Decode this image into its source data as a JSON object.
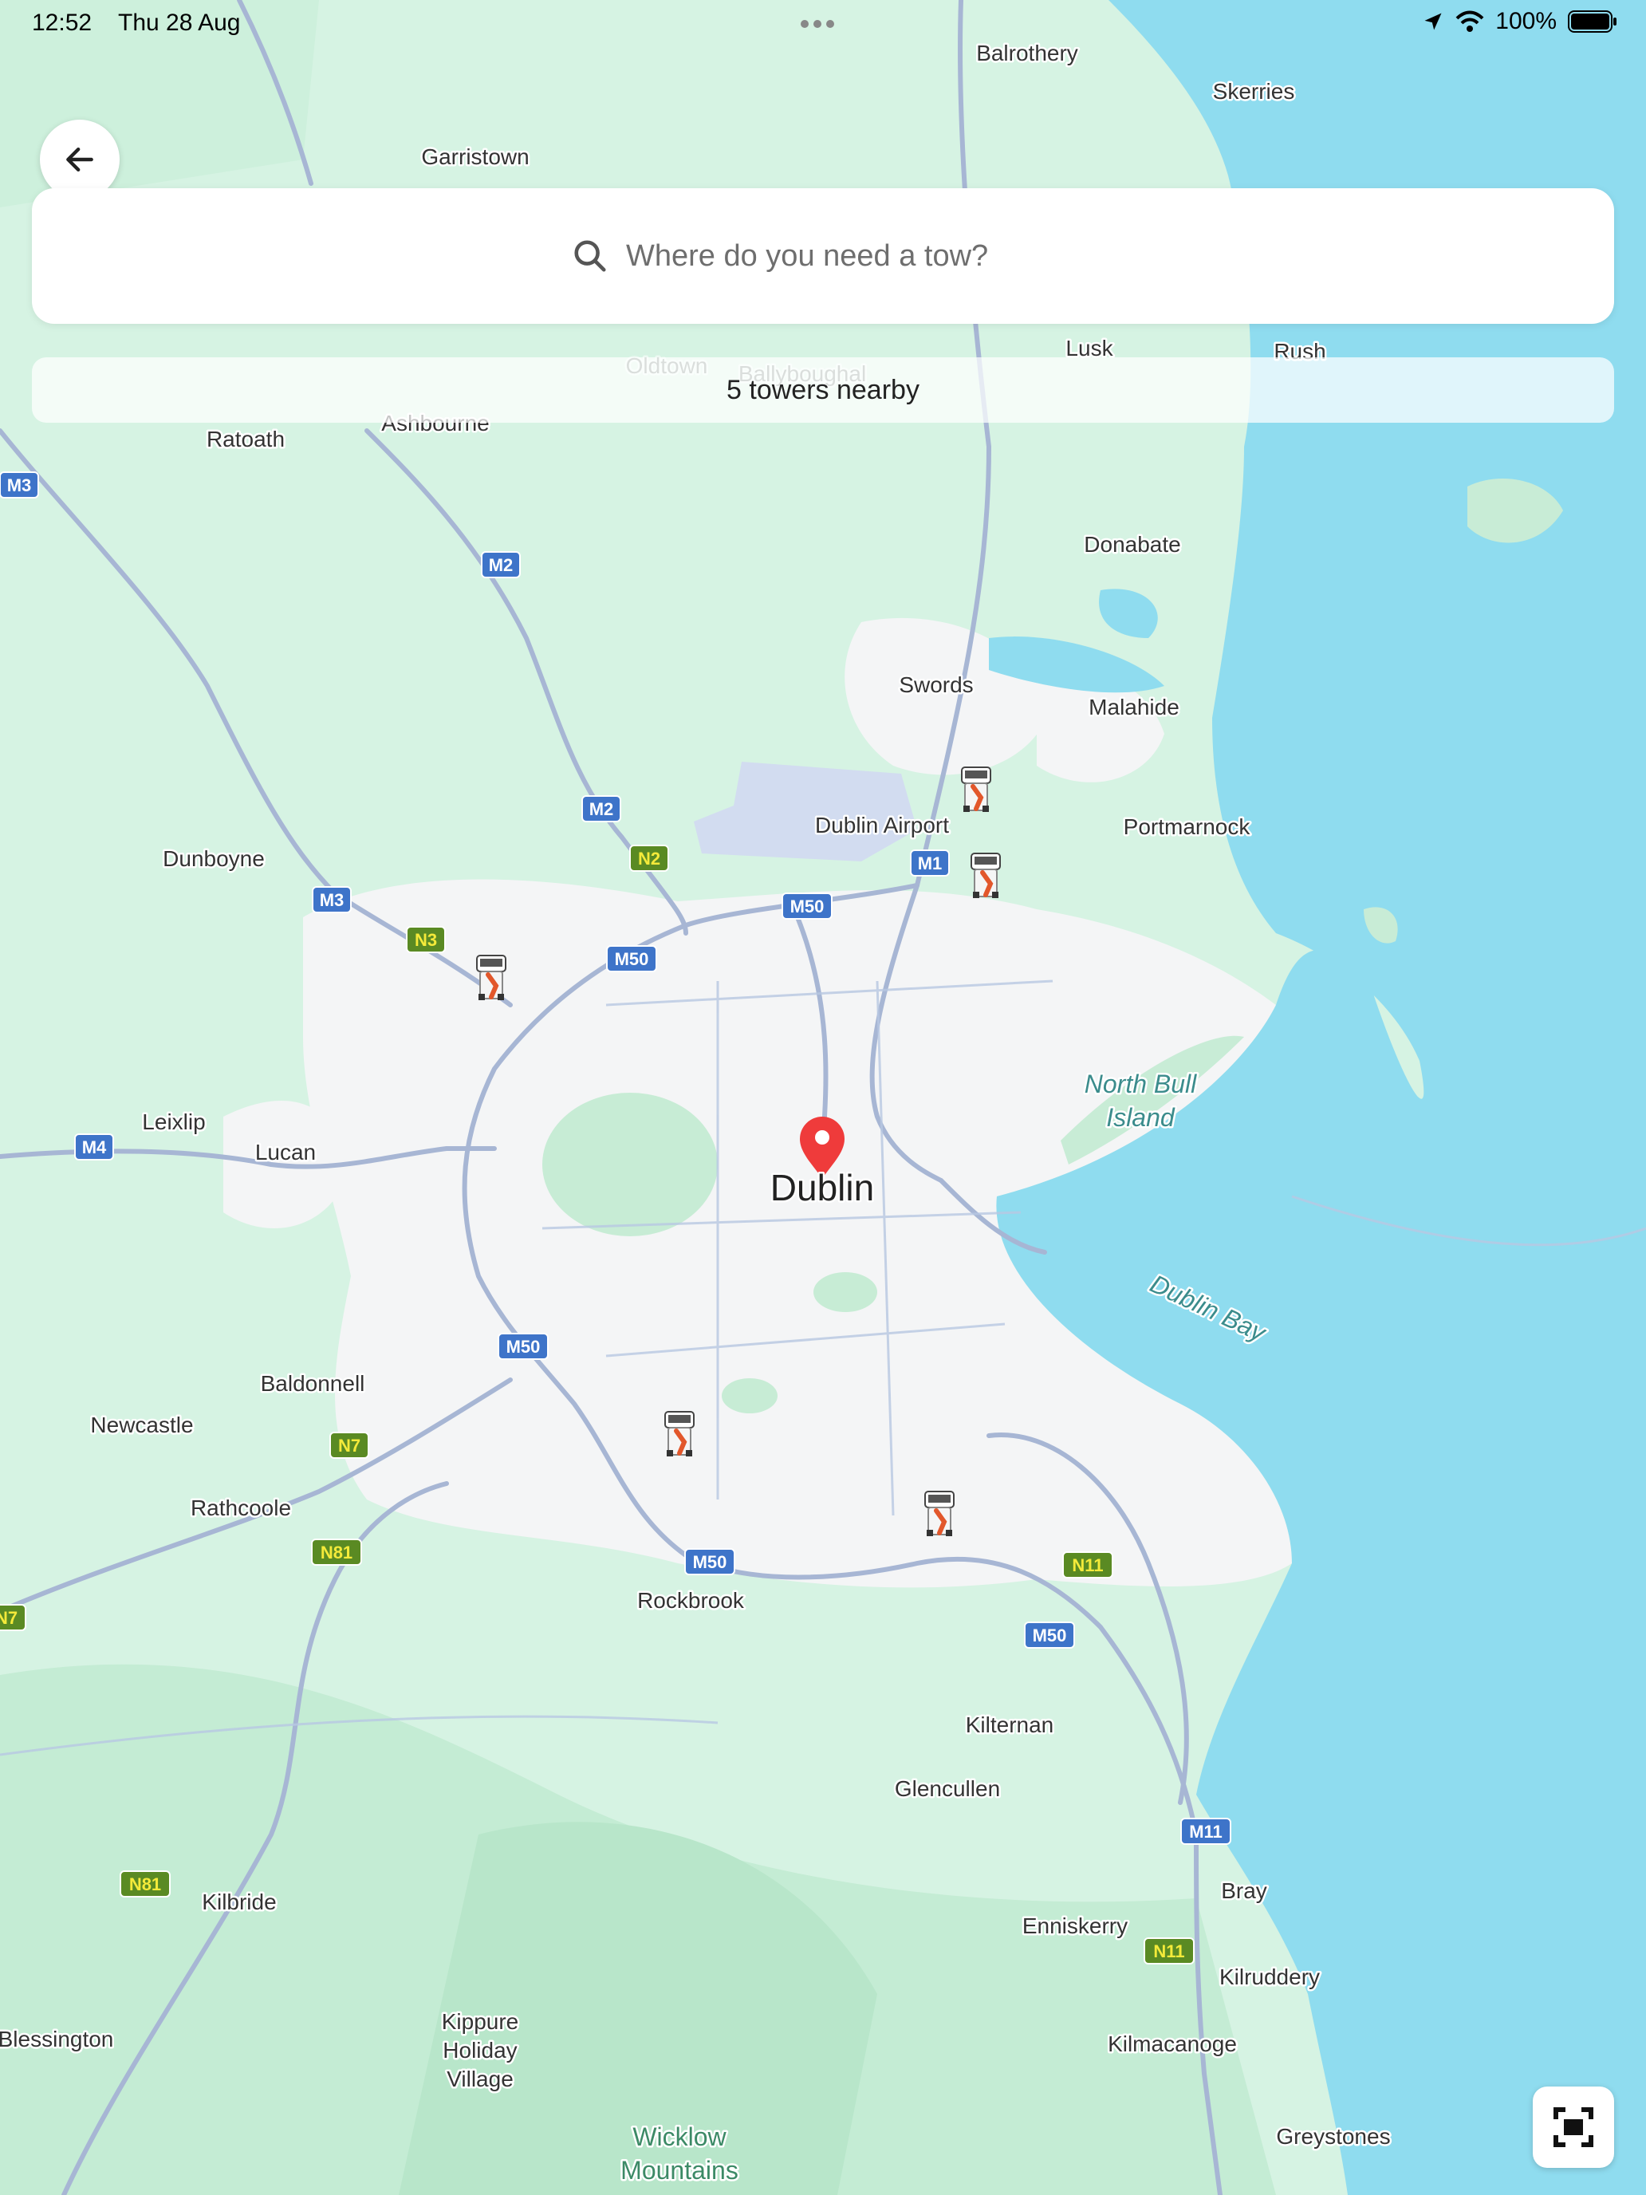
{
  "status_bar": {
    "time": "12:52",
    "date": "Thu 28 Aug",
    "battery": "100%"
  },
  "search": {
    "placeholder": "Where do you need a tow?"
  },
  "nearby": {
    "text": "5 towers nearby"
  },
  "map": {
    "city_label": "Dublin",
    "places": [
      "Balrothery",
      "Skerries",
      "Garristown",
      "Ratoath",
      "Ashbourne",
      "Lusk",
      "Rush",
      "Oldtown",
      "Ballyboughal",
      "Donabate",
      "Swords",
      "Malahide",
      "Dublin Airport",
      "Portmarnock",
      "Dunboyne",
      "Leixlip",
      "Lucan",
      "Baldonnell",
      "Newcastle",
      "Rathcoole",
      "Rockbrook",
      "Kilternan",
      "Glencullen",
      "Bray",
      "Kilbride",
      "Enniskerry",
      "Kilruddery",
      "Kilmacanoge",
      "Greystones",
      "Blessington",
      "Kippure Holiday Village",
      "Ratoath"
    ],
    "water_labels": [
      "North Bull Island",
      "Dublin Bay"
    ],
    "mountain_labels": [
      "Wicklow Mountains"
    ],
    "road_shields": [
      "M1",
      "M2",
      "M3",
      "M4",
      "M11",
      "M50",
      "N2",
      "N3",
      "N7",
      "N11",
      "N81"
    ],
    "tow_trucks_count": 5
  },
  "colors": {
    "land": "#d6f3e3",
    "urban": "#f4f5f6",
    "sea": "#8fdcef",
    "road": "#a7b6d4",
    "pin": "#ef3b3b",
    "motorway_shield": "#3e74c9",
    "national_shield": "#5a8a23"
  },
  "icons": {
    "back": "arrow-left-icon",
    "search": "search-icon",
    "fit": "fit-to-screen-icon",
    "pin": "location-pin-icon",
    "tow": "tow-truck-icon"
  }
}
